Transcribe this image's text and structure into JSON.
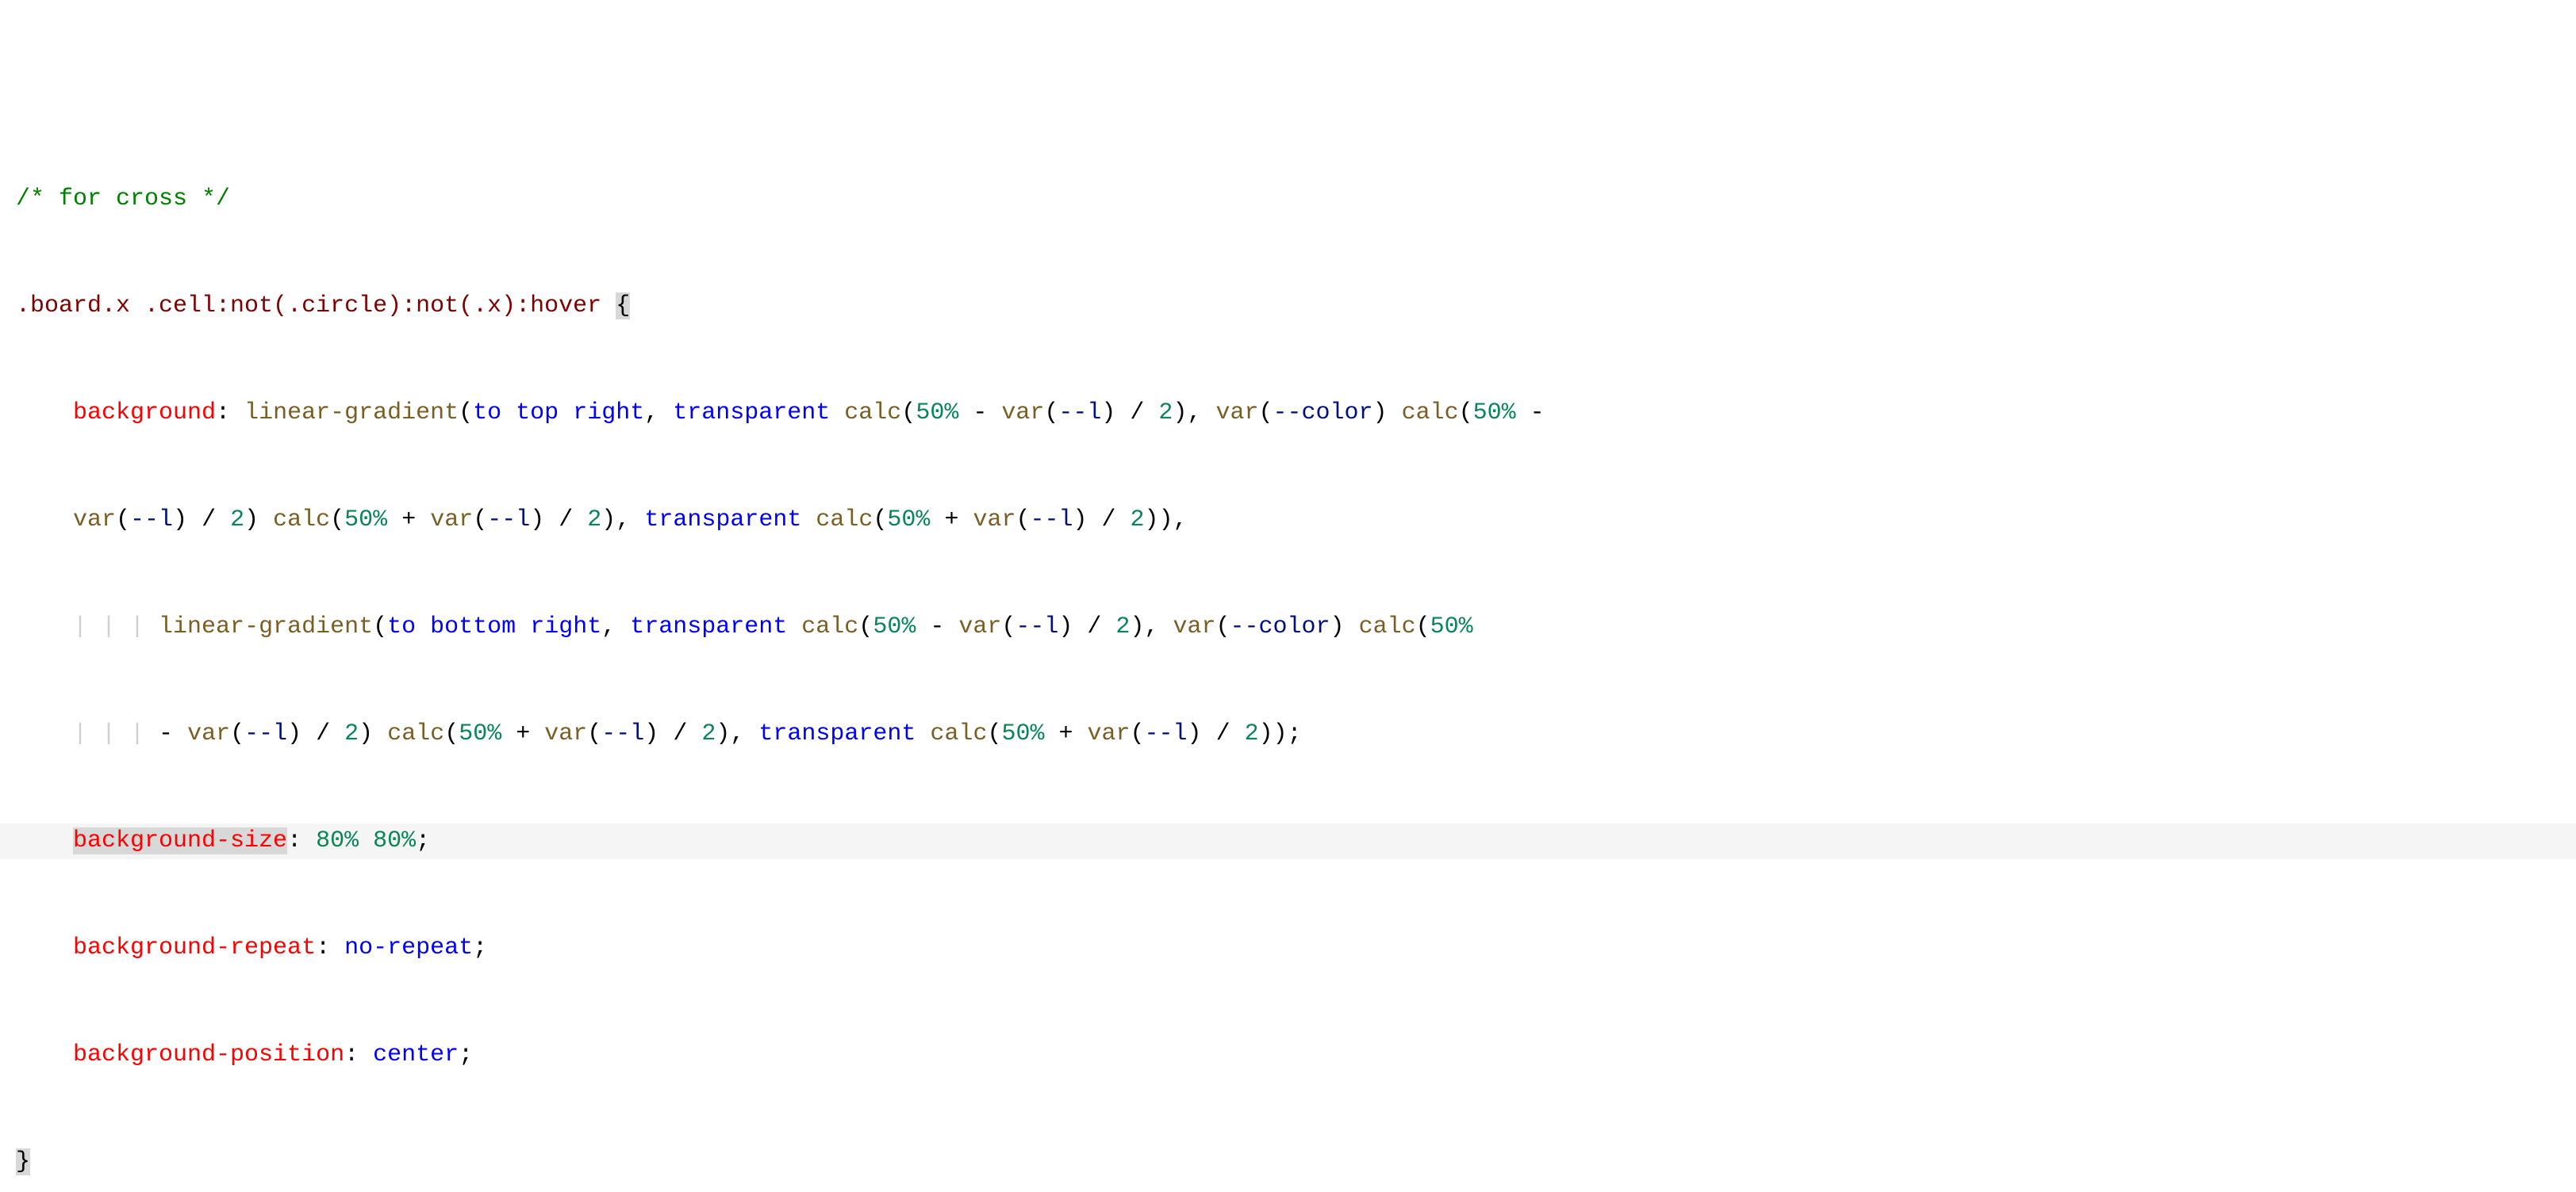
{
  "code": {
    "comment": "/* for cross */",
    "selector": ".board.x .cell",
    "pseudo1": ":not(",
    "notArg1": ".circle",
    "pseudo2": "):not(",
    "notArg2": ".x",
    "pseudo3": "):hover",
    "braceOpen": " {",
    "indent1": "    ",
    "p_background": "background",
    "colon": ": ",
    "fn_lingrad": "linear-gradient",
    "lp": "(",
    "rp": ")",
    "kw_to": "to",
    "kw_top": "top",
    "kw_bottom": "bottom",
    "kw_right": "right",
    "kw_transparent": "transparent",
    "comma": ", ",
    "fn_calc": "calc",
    "fn_var": "var",
    "num_50pct": "50%",
    "op_minus": " - ",
    "op_plus": " + ",
    "var_l": "--l",
    "var_color": "--color",
    "op_div2": " / ",
    "num_2": "2",
    "semicolon": ";",
    "deepIndent": "            ",
    "p_bgsize": "background-size",
    "v_bgsize": "80% 80%",
    "p_bgrepeat": "background-repeat",
    "v_bgrepeat": "no-repeat",
    "p_bgpos": "background-position",
    "v_bgpos": "center",
    "braceClose": "}",
    "sp": " ",
    "guides": "| | | "
  }
}
